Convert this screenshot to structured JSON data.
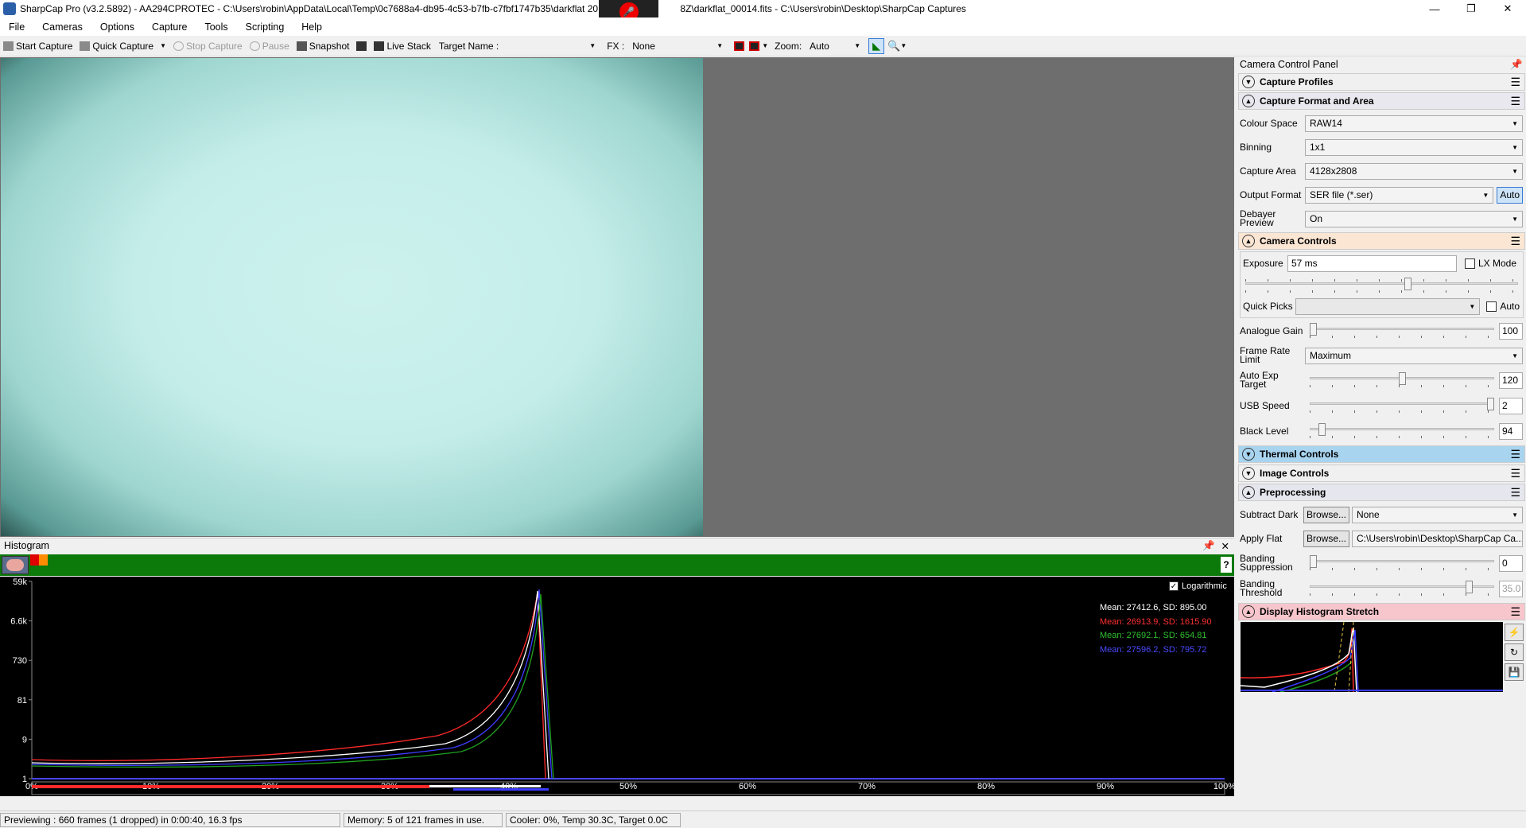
{
  "window": {
    "title": "SharpCap Pro (v3.2.5892) - AA294CPROTEC - C:\\Users\\robin\\AppData\\Local\\Temp\\0c7688a4-db95-4c53-b7fb-c7fbf1747b35\\darkflat 2018",
    "title_tail": "8Z\\darkflat_00014.fits - C:\\Users\\robin\\Desktop\\SharpCap Captures",
    "minimize": "—",
    "maximize": "❐",
    "close": "✕"
  },
  "menu": [
    "File",
    "Cameras",
    "Options",
    "Capture",
    "Tools",
    "Scripting",
    "Help"
  ],
  "toolbar": {
    "start_capture": "Start Capture",
    "quick_capture": "Quick Capture",
    "stop_capture": "Stop Capture",
    "pause": "Pause",
    "snapshot": "Snapshot",
    "live_stack": "Live Stack",
    "target_name_label": "Target Name :",
    "target_name_value": "",
    "fx_label": "FX :",
    "fx_value": "None",
    "zoom_label": "Zoom:",
    "zoom_value": "Auto"
  },
  "histogram": {
    "title": "Histogram",
    "logarithmic_label": "Logarithmic",
    "logarithmic_checked": true,
    "y_ticks": [
      "59k",
      "6.6k",
      "730",
      "81",
      "9",
      "1"
    ],
    "x_ticks": [
      "0%",
      "10%",
      "20%",
      "30%",
      "40%",
      "50%",
      "60%",
      "70%",
      "80%",
      "90%",
      "100%"
    ],
    "stats": [
      {
        "text": "Mean: 27412.6, SD: 895.00",
        "color": "#ffffff"
      },
      {
        "text": "Mean: 26913.9, SD: 1615.90",
        "color": "#ff3030"
      },
      {
        "text": "Mean: 27692.1, SD: 654.81",
        "color": "#30c030"
      },
      {
        "text": "Mean: 27596.2, SD: 795.72",
        "color": "#4a4aff"
      }
    ],
    "help": "?"
  },
  "status": {
    "preview": "Previewing : 660 frames (1 dropped) in 0:00:40, 16.3 fps",
    "memory": "Memory: 5 of 121 frames in use.",
    "cooler": "Cooler: 0%, Temp 30.3C, Target 0.0C"
  },
  "ccp": {
    "title": "Camera Control Panel",
    "sections": {
      "capture_profiles": "Capture Profiles",
      "capture_format": "Capture Format and Area",
      "camera_controls": "Camera Controls",
      "thermal": "Thermal Controls",
      "image_controls": "Image Controls",
      "preprocessing": "Preprocessing",
      "display_stretch": "Display Histogram Stretch"
    },
    "section_colors": {
      "capture_format": "#e8e8ee",
      "camera_controls": "#fbe6d4",
      "thermal": "#a8d4f0",
      "preprocessing": "#e6e6ee",
      "display_stretch": "#f7c6cc"
    },
    "colour_space": {
      "label": "Colour Space",
      "value": "RAW14"
    },
    "binning": {
      "label": "Binning",
      "value": "1x1"
    },
    "capture_area": {
      "label": "Capture Area",
      "value": "4128x2808"
    },
    "output_format": {
      "label": "Output Format",
      "value": "SER file (*.ser)",
      "auto": "Auto"
    },
    "debayer": {
      "label": "Debayer Preview",
      "value": "On"
    },
    "exposure": {
      "label": "Exposure",
      "value": "57 ms",
      "lx_mode": "LX Mode"
    },
    "quick_picks": {
      "label": "Quick Picks",
      "value": "",
      "auto": "Auto"
    },
    "analogue_gain": {
      "label": "Analogue Gain",
      "value": "100",
      "level": 0.0
    },
    "frame_rate": {
      "label": "Frame Rate Limit",
      "value": "Maximum"
    },
    "auto_exp_target": {
      "label": "Auto Exp Target",
      "value": "120",
      "level": 0.5
    },
    "usb_speed": {
      "label": "USB Speed",
      "value": "2",
      "level": 1.0
    },
    "black_level": {
      "label": "Black Level",
      "value": "94",
      "level": 0.05
    },
    "subtract_dark": {
      "label": "Subtract Dark",
      "browse": "Browse...",
      "value": "None"
    },
    "apply_flat": {
      "label": "Apply Flat",
      "browse": "Browse...",
      "value": "C:\\Users\\robin\\Desktop\\SharpCap Ca..."
    },
    "banding_suppression": {
      "label": "Banding Suppression",
      "value": "0",
      "level": 0.0
    },
    "banding_threshold": {
      "label": "Banding Threshold",
      "value": "35.0",
      "level": 0.88
    }
  }
}
